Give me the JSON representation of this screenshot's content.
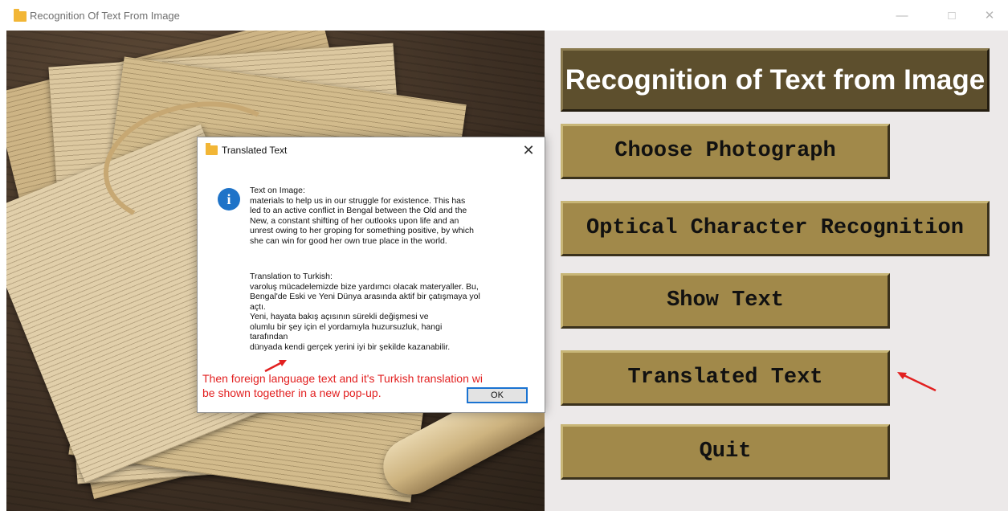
{
  "window": {
    "title": "Recognition Of Text From Image",
    "controls": {
      "minimize": "—",
      "maximize": "□",
      "close": "✕"
    }
  },
  "panel": {
    "title": "Recognition of Text from Image",
    "buttons": {
      "choose": "Choose Photograph",
      "ocr": "Optical Character Recognition",
      "show": "Show Text",
      "translated": "Translated Text",
      "quit": "Quit"
    }
  },
  "dialog": {
    "title": "Translated Text",
    "close": "✕",
    "icon": "i",
    "text_on_image": "Text on Image:\nmaterials to help us in our struggle for existence. This has\nled to an active conflict in Bengal between the Old and the\nNew, a constant shifting of her outlooks upon life and an\nunrest owing to her groping for something positive, by which\nshe can win for good her own true place in the world.",
    "translation": "Translation to Turkish:\nvaroluş mücadelemizde bize yardımcı olacak materyaller. Bu,\nBengal'de Eski ve Yeni Dünya arasında aktif bir çatışmaya yol\naçtı.\nYeni, hayata bakış açısının sürekli değişmesi ve\nolumlu bir şey için el yordamıyla huzursuzluk, hangi\ntarafından\ndünyada kendi gerçek yerini iyi bir şekilde kazanabilir.",
    "ok_label": "OK"
  },
  "annotation": {
    "text": "Then foreign language text and it's Turkish translation wi\nbe shown together in a new pop-up.",
    "color": "#e22020"
  },
  "colors": {
    "button_face": "#a1894a",
    "title_face": "#5d4f2d",
    "panel_bg": "#ece9e9"
  }
}
